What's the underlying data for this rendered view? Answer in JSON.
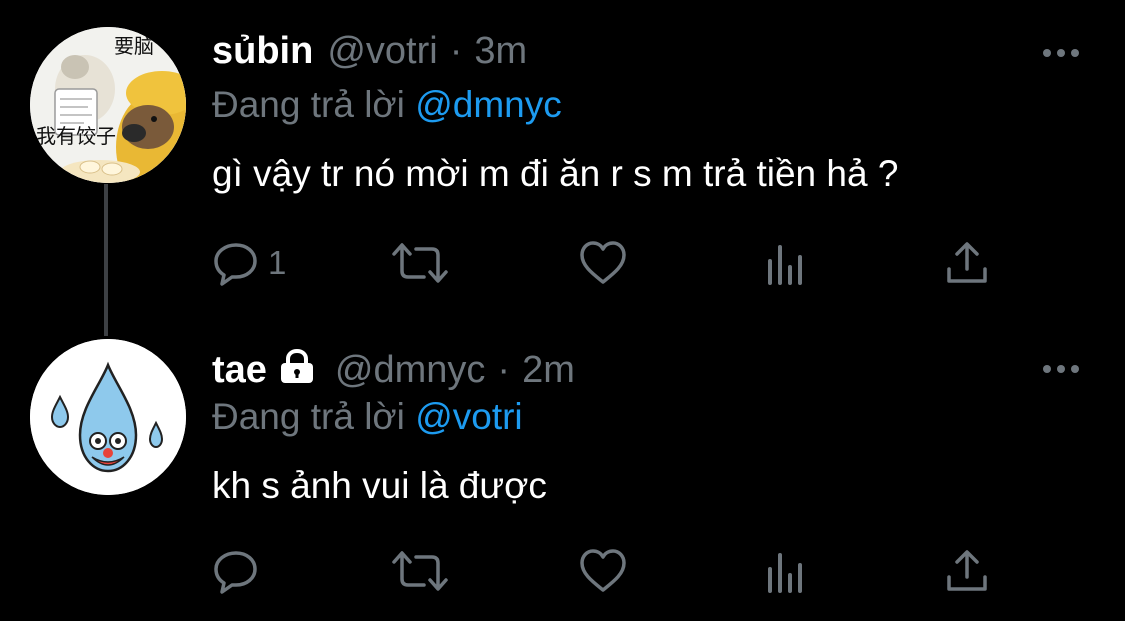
{
  "tweets": [
    {
      "name": "sủbin",
      "handle": "@votri",
      "separator": "·",
      "time": "3m",
      "replying_prefix": "Đang trả lời",
      "replying_to": "@dmnyc",
      "text": "gì vậy tr nó mời m đi ăn r s m trả tiền hả ?",
      "reply_count": "1",
      "avatar_caption_top": "要脑",
      "avatar_caption_bottom": "我有饺子",
      "protected": false
    },
    {
      "name": "tae",
      "handle": "@dmnyc",
      "separator": "·",
      "time": "2m",
      "replying_prefix": "Đang trả lời",
      "replying_to": "@votri",
      "text": "kh s ảnh vui là được",
      "reply_count": "",
      "protected": true
    }
  ],
  "colors": {
    "background": "#000000",
    "primary_text": "#ffffff",
    "secondary_text": "#6e767d",
    "accent": "#1d9bf0",
    "thread_line": "#3d4044"
  },
  "icons": [
    "reply-icon",
    "retweet-icon",
    "like-icon",
    "views-icon",
    "share-icon",
    "more-icon",
    "lock-icon"
  ]
}
